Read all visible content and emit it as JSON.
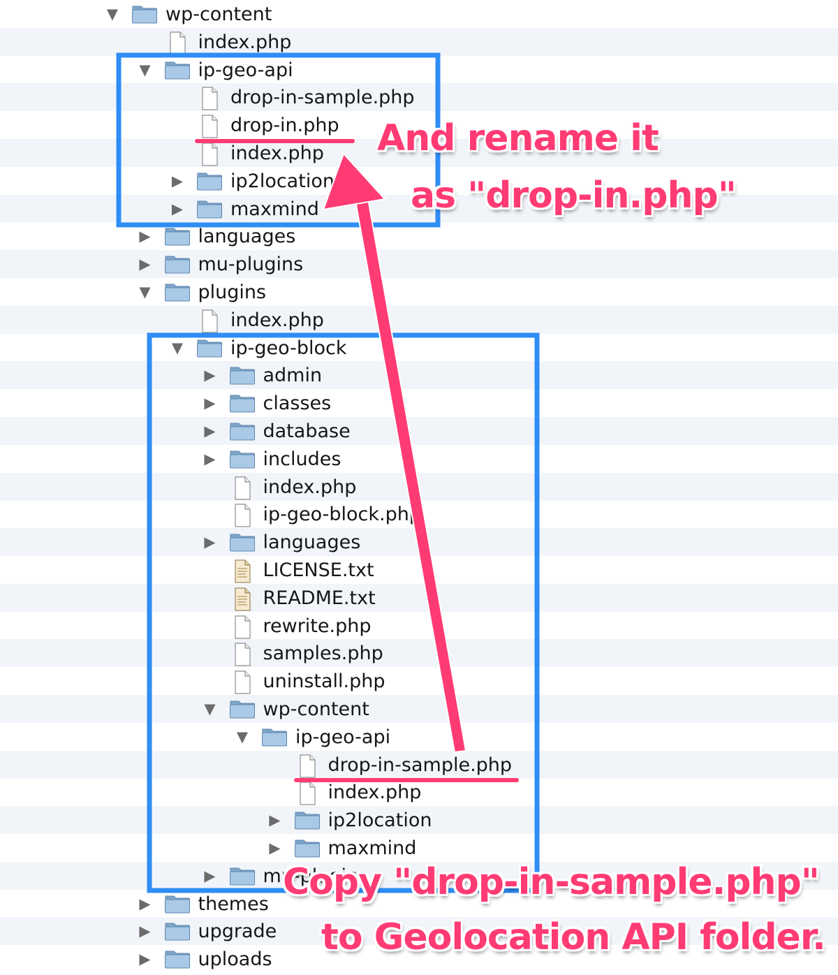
{
  "tree": {
    "rows": [
      {
        "label": "wp-content",
        "icon": "folder-icon",
        "expander": "expanded"
      },
      {
        "label": "index.php",
        "icon": "file-icon",
        "expander": "none"
      },
      {
        "label": "ip-geo-api",
        "icon": "folder-icon",
        "expander": "expanded"
      },
      {
        "label": "drop-in-sample.php",
        "icon": "file-icon",
        "expander": "none"
      },
      {
        "label": "drop-in.php",
        "icon": "file-icon",
        "expander": "none"
      },
      {
        "label": "index.php",
        "icon": "file-icon",
        "expander": "none"
      },
      {
        "label": "ip2location",
        "icon": "folder-icon",
        "expander": "collapsed"
      },
      {
        "label": "maxmind",
        "icon": "folder-icon",
        "expander": "collapsed"
      },
      {
        "label": "languages",
        "icon": "folder-icon",
        "expander": "collapsed"
      },
      {
        "label": "mu-plugins",
        "icon": "folder-icon",
        "expander": "collapsed"
      },
      {
        "label": "plugins",
        "icon": "folder-icon",
        "expander": "expanded"
      },
      {
        "label": "index.php",
        "icon": "file-icon",
        "expander": "none"
      },
      {
        "label": "ip-geo-block",
        "icon": "folder-icon",
        "expander": "expanded"
      },
      {
        "label": "admin",
        "icon": "folder-icon",
        "expander": "collapsed"
      },
      {
        "label": "classes",
        "icon": "folder-icon",
        "expander": "collapsed"
      },
      {
        "label": "database",
        "icon": "folder-icon",
        "expander": "collapsed"
      },
      {
        "label": "includes",
        "icon": "folder-icon",
        "expander": "collapsed"
      },
      {
        "label": "index.php",
        "icon": "file-icon",
        "expander": "none"
      },
      {
        "label": "ip-geo-block.php",
        "icon": "file-icon",
        "expander": "none"
      },
      {
        "label": "languages",
        "icon": "folder-icon",
        "expander": "collapsed"
      },
      {
        "label": "LICENSE.txt",
        "icon": "text-file-icon",
        "expander": "none"
      },
      {
        "label": "README.txt",
        "icon": "text-file-icon",
        "expander": "none"
      },
      {
        "label": "rewrite.php",
        "icon": "file-icon",
        "expander": "none"
      },
      {
        "label": "samples.php",
        "icon": "file-icon",
        "expander": "none"
      },
      {
        "label": "uninstall.php",
        "icon": "file-icon",
        "expander": "none"
      },
      {
        "label": "wp-content",
        "icon": "folder-icon",
        "expander": "expanded"
      },
      {
        "label": "ip-geo-api",
        "icon": "folder-icon",
        "expander": "expanded"
      },
      {
        "label": "drop-in-sample.php",
        "icon": "file-icon",
        "expander": "none"
      },
      {
        "label": "index.php",
        "icon": "file-icon",
        "expander": "none"
      },
      {
        "label": "ip2location",
        "icon": "folder-icon",
        "expander": "collapsed"
      },
      {
        "label": "maxmind",
        "icon": "folder-icon",
        "expander": "collapsed"
      },
      {
        "label": "mu-plugins",
        "icon": "folder-icon",
        "expander": "collapsed"
      },
      {
        "label": "themes",
        "icon": "folder-icon",
        "expander": "collapsed"
      },
      {
        "label": "upgrade",
        "icon": "folder-icon",
        "expander": "collapsed"
      },
      {
        "label": "uploads",
        "icon": "folder-icon",
        "expander": "collapsed"
      }
    ]
  },
  "annotations": {
    "rename_line1": "And rename it",
    "rename_line2": "as \"drop-in.php\"",
    "copy_line1": "Copy \"drop-in-sample.php\"",
    "copy_line2": "to Geolocation API folder."
  },
  "colors": {
    "highlight_box": "#2f8df5",
    "annotation": "#ff3b73",
    "row_stripe": "#f1f5fa",
    "folder": "#8fb6d9"
  }
}
